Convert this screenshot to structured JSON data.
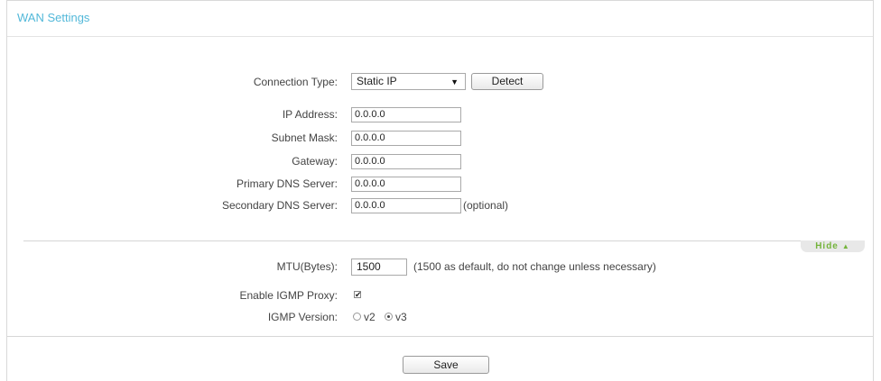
{
  "panel": {
    "title": "WAN Settings"
  },
  "connection": {
    "label": "Connection Type:",
    "selected": "Static IP",
    "detect_label": "Detect"
  },
  "fields": [
    {
      "label": "IP Address:",
      "value": "0.0.0.0"
    },
    {
      "label": "Subnet Mask:",
      "value": "0.0.0.0"
    },
    {
      "label": "Gateway:",
      "value": "0.0.0.0"
    },
    {
      "label": "Primary DNS Server:",
      "value": "0.0.0.0"
    },
    {
      "label": "Secondary DNS Server:",
      "value": "0.0.0.0",
      "note": "(optional)"
    }
  ],
  "advanced": {
    "toggle_label": "Hide",
    "mtu": {
      "label": "MTU(Bytes):",
      "value": "1500",
      "note": "(1500 as default, do not change unless necessary)"
    },
    "igmp_proxy": {
      "label": "Enable IGMP Proxy:",
      "checked": true
    },
    "igmp_version": {
      "label": "IGMP Version:",
      "options": [
        "v2",
        "v3"
      ],
      "selected": "v3"
    }
  },
  "actions": {
    "save_label": "Save"
  },
  "colors": {
    "title": "#52b8d9",
    "hide_text": "#74b43b"
  }
}
